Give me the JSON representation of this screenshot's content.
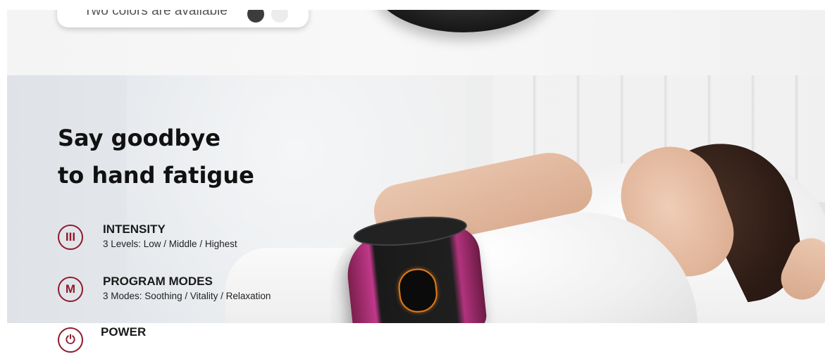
{
  "colors_section": {
    "label": "Two colors are available",
    "swatches": [
      "#3c3c3c",
      "#ececec"
    ]
  },
  "hero": {
    "headline_line1": "Say goodbye",
    "headline_line2": "to hand fatigue",
    "features": [
      {
        "icon": "intensity-bars-icon",
        "title": "INTENSITY",
        "desc": "3 Levels: Low / Middle / Highest",
        "glyph": "III"
      },
      {
        "icon": "mode-m-icon",
        "title": "PROGRAM MODES",
        "desc": "3 Modes: Soothing / Vitality / Relaxation",
        "glyph": "M"
      },
      {
        "icon": "power-icon",
        "title": "POWER",
        "desc": "",
        "glyph": "⏻"
      }
    ],
    "accent_color": "#8e1b2d"
  }
}
